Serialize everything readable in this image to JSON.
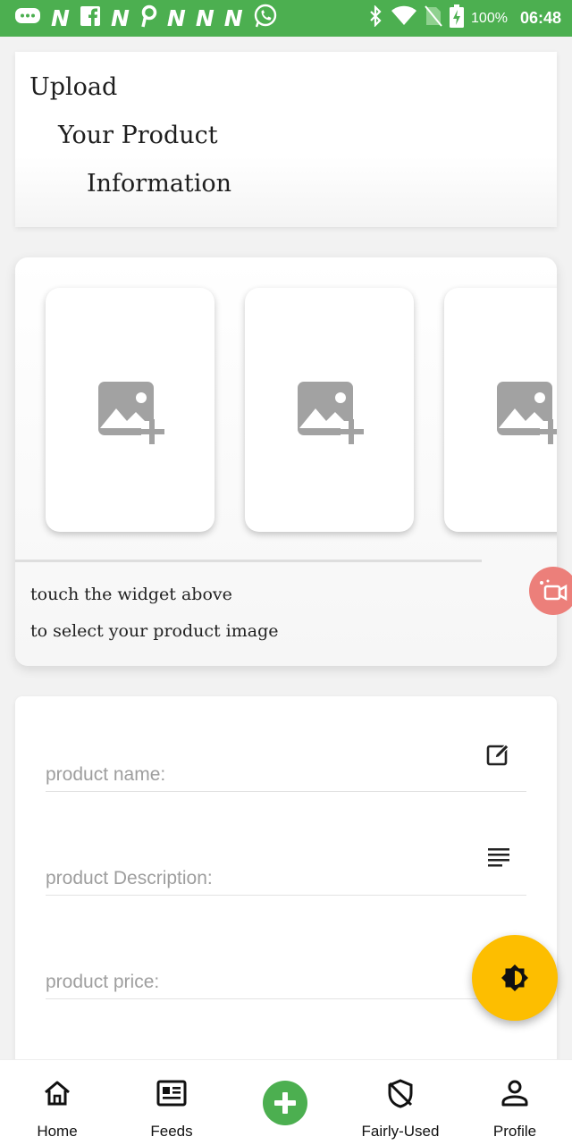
{
  "status_bar": {
    "notification_icons": [
      "message-icon",
      "n-app-icon",
      "facebook-icon",
      "n-app-icon",
      "pinterest-icon",
      "n-app-icon",
      "n-app-icon",
      "n-app-icon",
      "whatsapp-icon"
    ],
    "battery": "100%",
    "time": "06:48",
    "color": "#4caf50"
  },
  "header": {
    "line1": "Upload",
    "line2": "Your Product",
    "line3": "Information"
  },
  "image_picker": {
    "slot_icon": "add-photo-icon",
    "hint_line1": "touch the widget above",
    "hint_line2": "to select your product image"
  },
  "form": {
    "name_placeholder": "product name:",
    "name_value": "",
    "description_placeholder": "product Description:",
    "description_value": "",
    "price_placeholder": "product price:",
    "price_value": ""
  },
  "fab": {
    "icon": "brightness-icon",
    "color": "#fdbe00"
  },
  "bottom_nav": {
    "home": "Home",
    "feeds": "Feeds",
    "add_icon": "plus-icon",
    "fairly_used": "Fairly-Used",
    "profile": "Profile",
    "accent": "#4caf50"
  }
}
